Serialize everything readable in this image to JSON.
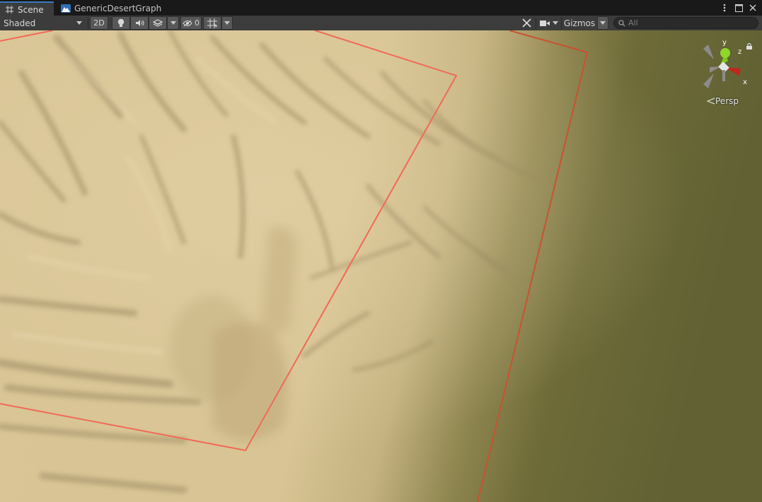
{
  "tabs": [
    {
      "label": "Scene",
      "icon": "grid-icon",
      "active": true
    },
    {
      "label": "GenericDesertGraph",
      "icon": "terrain-mountain-icon",
      "active": false
    }
  ],
  "window_controls": [
    "more-menu-icon",
    "maximize-icon",
    "close-icon"
  ],
  "toolbar": {
    "draw_mode": "Shaded",
    "toggle_2d": "2D",
    "hidden_count": "0",
    "gizmos_label": "Gizmos",
    "search_placeholder": "All"
  },
  "scene_gizmo": {
    "axes": {
      "x": "x",
      "y": "y",
      "z": "z"
    },
    "projection_label": "Persp",
    "colors": {
      "x": "#c0271d",
      "y": "#7ec71e",
      "z": "#2f63e0"
    }
  },
  "colors": {
    "sand": "#dcc69a",
    "ground": "#6b6a36",
    "bounds_line": "#f26a55",
    "active_tab_accent": "#3a79bb"
  }
}
